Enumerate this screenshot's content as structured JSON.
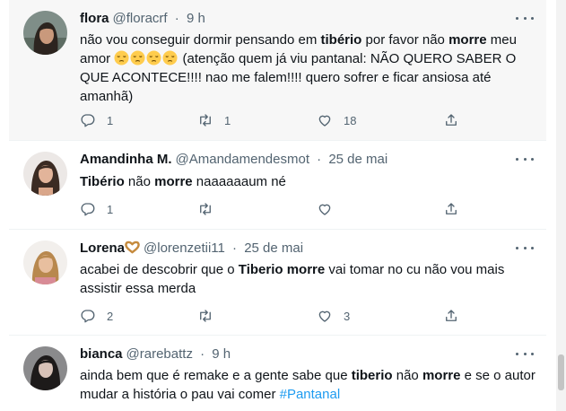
{
  "tweets": [
    {
      "name": "flora",
      "handle": "@floracrf",
      "dot": "·",
      "time": "9 h",
      "text": {
        "t1": "não vou conseguir dormir pensando em ",
        "b1": "tibério",
        "t2": " por favor não ",
        "b2": "morre",
        "t3": " meu amor ",
        "t4": " (atenção quem já viu pantanal: NÃO QUERO SABER O QUE ACONTECE!!!! nao me falem!!!! quero sofrer e ficar ansiosa até amanhã)"
      },
      "emoji_count": 4,
      "replies": "1",
      "retweets": "1",
      "likes": "18"
    },
    {
      "name": "Amandinha M.",
      "handle": "@Amandamendesmot",
      "dot": "·",
      "time": "25 de mai",
      "text": {
        "b1": "Tibério",
        "t1": " não ",
        "b2": "morre",
        "t2": " naaaaaaum né"
      },
      "replies": "1"
    },
    {
      "name": "Lorena",
      "handle": "@lorenzetii11",
      "dot": "·",
      "time": "25 de mai",
      "text": {
        "t1": "acabei de descobrir que o ",
        "b1": "Tiberio",
        "t2": " ",
        "b2": "morre",
        "t3": " vai tomar no cu não vou mais assistir essa merda"
      },
      "replies": "2",
      "likes": "3"
    },
    {
      "name": "bianca",
      "handle": "@rarebattz",
      "dot": "·",
      "time": "9 h",
      "text": {
        "t1": "ainda bem que é remake e a gente sabe que ",
        "b1": "tiberio",
        "t2": " não ",
        "b2": "morre",
        "t3": " e se o autor mudar a história o pau vai comer ",
        "tag": "#Pantanal"
      }
    }
  ],
  "icons": {
    "reply": "reply-icon",
    "retweet": "retweet-icon",
    "like": "heart-icon",
    "share": "share-icon",
    "more": "more-icon",
    "pensive": "pensive-face-emoji",
    "heart_hands": "heart-hands-emoji"
  },
  "colors": {
    "text": "#0f1419",
    "secondary": "#536471",
    "link": "#1d9bf0",
    "highlight_bg": "#f7f7f7",
    "emoji": "#ffcc4d"
  }
}
